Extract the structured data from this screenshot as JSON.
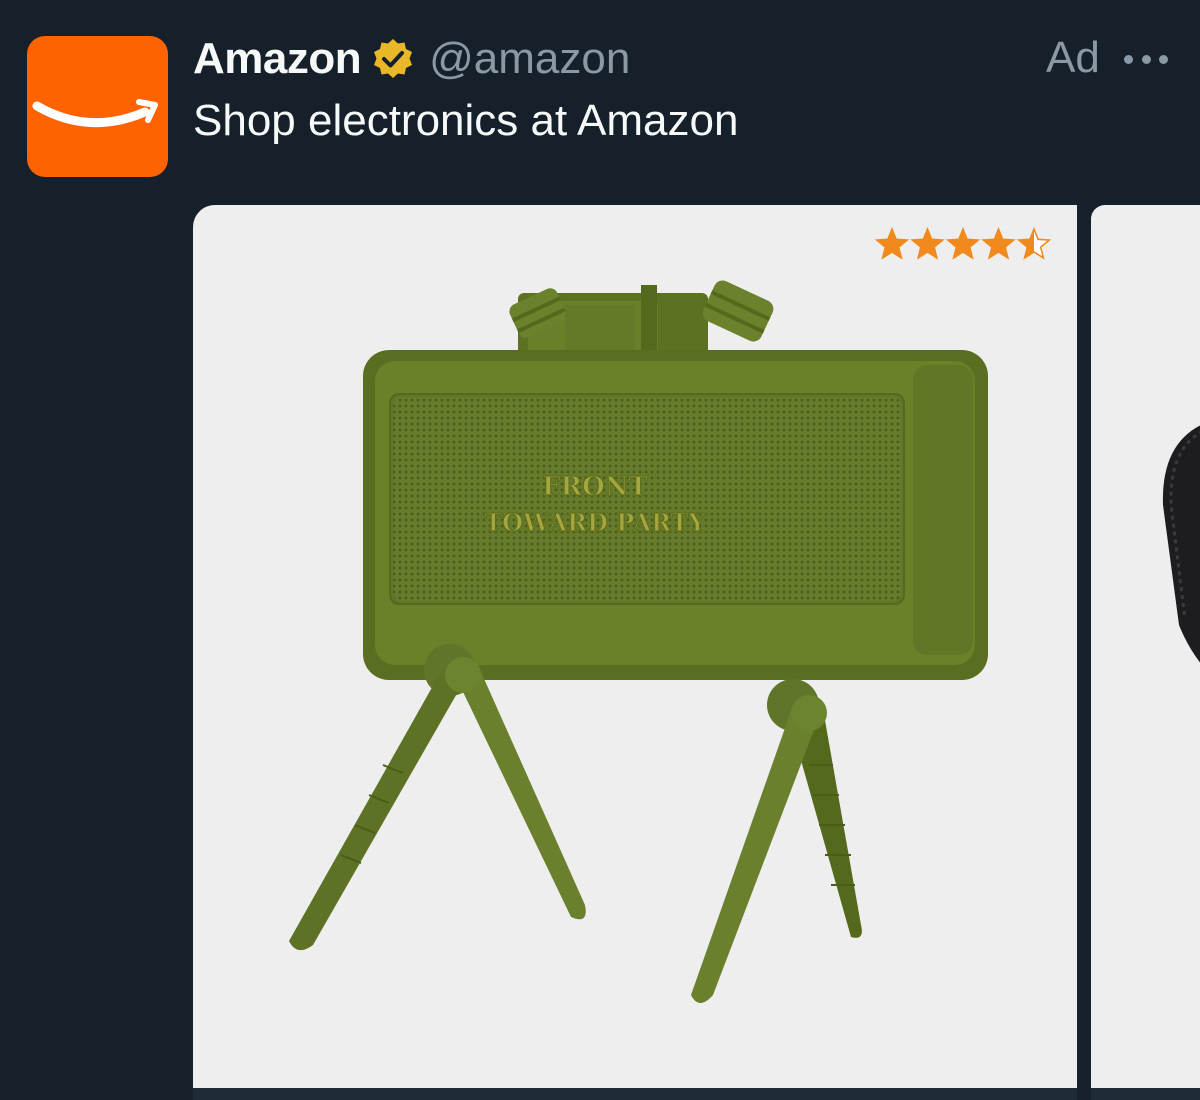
{
  "account": {
    "display_name": "Amazon",
    "handle": "@amazon",
    "verified_icon": "verified-badge-gold-icon",
    "avatar_icon": "amazon-smile-logo"
  },
  "post": {
    "text": "Shop electronics at Amazon",
    "ad_label": "Ad",
    "more_icon": "more-horizontal-icon"
  },
  "product": {
    "rating": 4.5,
    "rating_max": 5,
    "image_text_line1": "FRONT",
    "image_text_line2": "TOWARD PARTY"
  },
  "colors": {
    "background": "#15202b",
    "avatar": "#ff6200",
    "verified_badge": "#e8b829",
    "star_fill": "#f08a1c",
    "product_green": "#5f7322"
  }
}
